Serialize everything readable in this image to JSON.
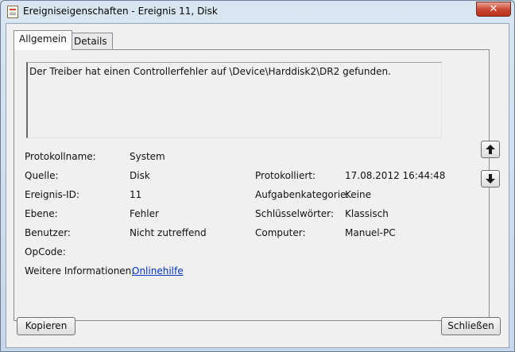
{
  "window": {
    "title": "Ereigniseigenschaften - Ereignis 11, Disk",
    "close_label": "✕"
  },
  "tabs": [
    {
      "label": "Allgemein",
      "active": true
    },
    {
      "label": "Details",
      "active": false
    }
  ],
  "event": {
    "description": "Der Treiber hat einen Controllerfehler auf \\Device\\Harddisk2\\DR2 gefunden.",
    "fields_left": [
      {
        "label": "Protokollname:",
        "value": "System"
      },
      {
        "label": "Quelle:",
        "value": "Disk"
      },
      {
        "label": "Ereignis-ID:",
        "value": "11"
      },
      {
        "label": "Ebene:",
        "value": "Fehler"
      },
      {
        "label": "Benutzer:",
        "value": "Nicht zutreffend"
      },
      {
        "label": "OpCode:",
        "value": ""
      }
    ],
    "fields_right": [
      {
        "label": "Protokolliert:",
        "value": "17.08.2012 16:44:48"
      },
      {
        "label": "Aufgabenkategorie:",
        "value": "Keine"
      },
      {
        "label": "Schlüsselwörter:",
        "value": "Klassisch"
      },
      {
        "label": "Computer:",
        "value": "Manuel-PC"
      }
    ],
    "more_info_label": "Weitere Informationen:",
    "more_info_link": "Onlinehilfe"
  },
  "navigation": {
    "up_icon": "arrow-up-icon",
    "down_icon": "arrow-down-icon"
  },
  "buttons": {
    "copy": "Kopieren",
    "close": "Schließen"
  }
}
